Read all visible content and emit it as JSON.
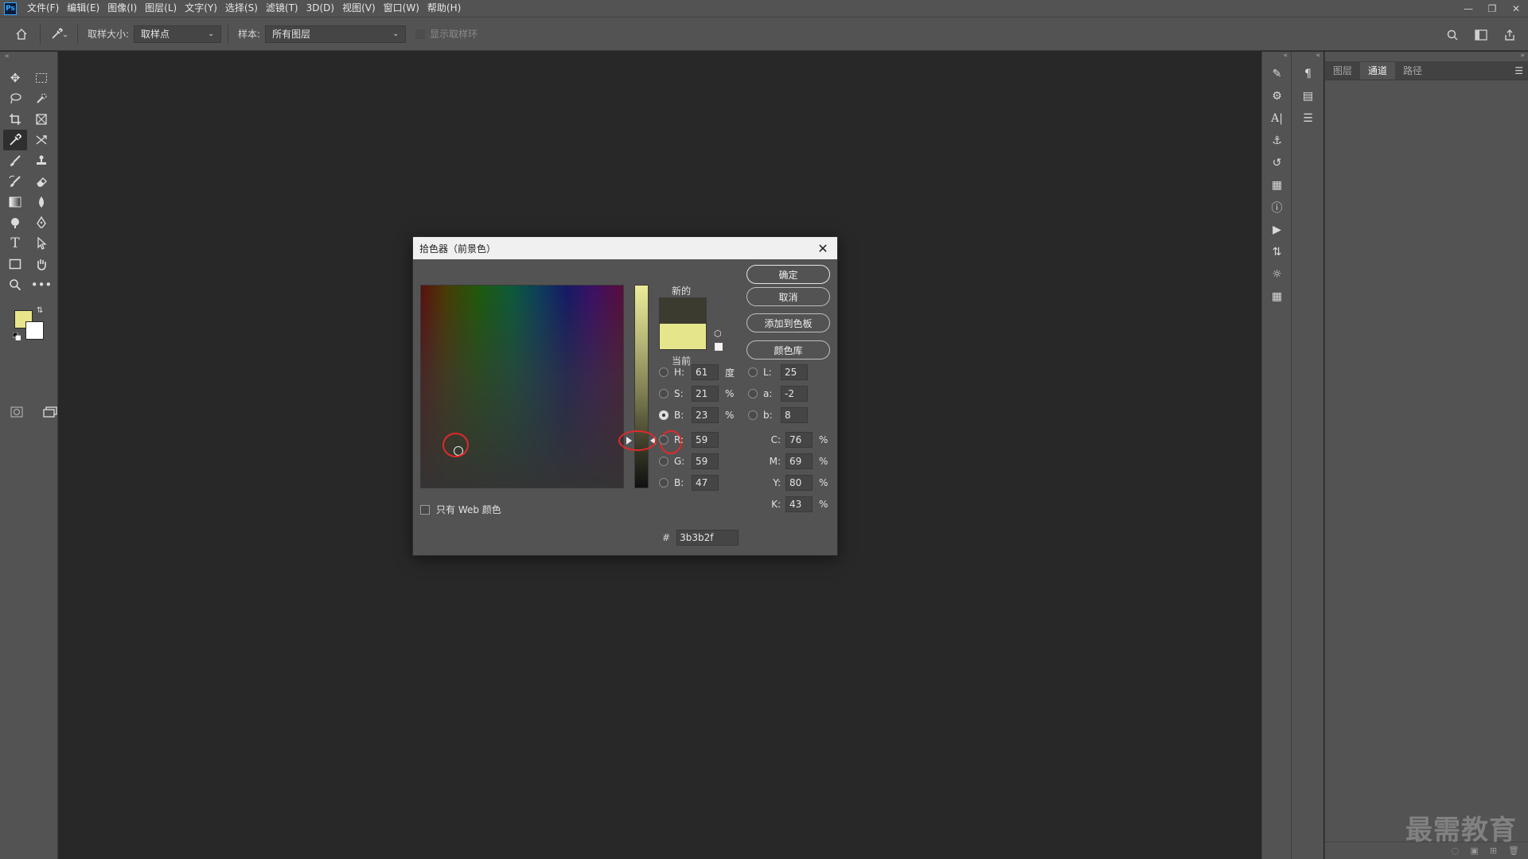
{
  "app": {
    "logo": "Ps",
    "menu": [
      "文件(F)",
      "编辑(E)",
      "图像(I)",
      "图层(L)",
      "文字(Y)",
      "选择(S)",
      "滤镜(T)",
      "3D(D)",
      "视图(V)",
      "窗口(W)",
      "帮助(H)"
    ]
  },
  "options_bar": {
    "sample_size_label": "取样大小:",
    "sample_size_value": "取样点",
    "sample_label": "样本:",
    "sample_value": "所有图层",
    "show_ring_label": "显示取样环"
  },
  "colors": {
    "foreground": "#e8e58a",
    "background": "#ffffff",
    "new_color": "#3b3b2f",
    "current_color": "#e5e58c",
    "highlight": "#e0292b"
  },
  "panels": {
    "tabs": [
      "图层",
      "通道",
      "路径"
    ],
    "active_tab": "通道"
  },
  "watermark": "最需教育",
  "dialog": {
    "title": "拾色器（前景色）",
    "new_label": "新的",
    "current_label": "当前",
    "buttons": {
      "ok": "确定",
      "cancel": "取消",
      "add_to_swatches": "添加到色板",
      "color_libraries": "颜色库"
    },
    "web_only_label": "只有 Web 颜色",
    "hsb": {
      "h": {
        "label": "H:",
        "value": "61",
        "unit": "度"
      },
      "s": {
        "label": "S:",
        "value": "21",
        "unit": "%"
      },
      "b": {
        "label": "B:",
        "value": "23",
        "unit": "%"
      }
    },
    "lab": {
      "l": {
        "label": "L:",
        "value": "25"
      },
      "a": {
        "label": "a:",
        "value": "-2"
      },
      "b": {
        "label": "b:",
        "value": "8"
      }
    },
    "rgb": {
      "r": {
        "label": "R:",
        "value": "59"
      },
      "g": {
        "label": "G:",
        "value": "59"
      },
      "b": {
        "label": "B:",
        "value": "47"
      }
    },
    "cmyk": {
      "c": {
        "label": "C:",
        "value": "76",
        "unit": "%"
      },
      "m": {
        "label": "M:",
        "value": "69",
        "unit": "%"
      },
      "y": {
        "label": "Y:",
        "value": "80",
        "unit": "%"
      },
      "k": {
        "label": "K:",
        "value": "43",
        "unit": "%"
      }
    },
    "hex_label": "#",
    "hex_value": "3b3b2f",
    "selected_mode": "B"
  }
}
